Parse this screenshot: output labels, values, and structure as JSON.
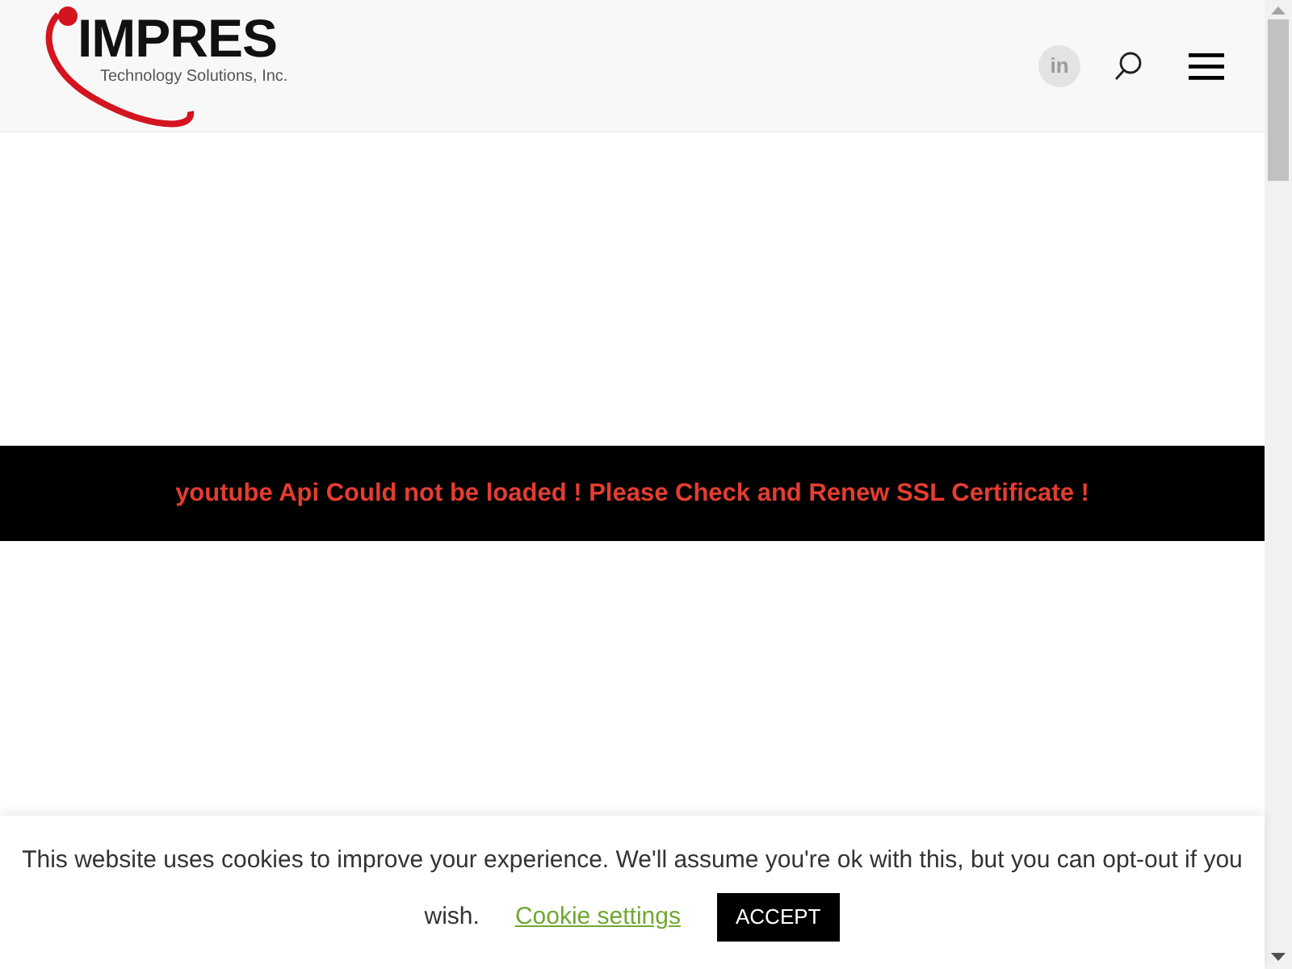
{
  "header": {
    "logo": {
      "name": "IMPRES",
      "tagline": "Technology Solutions, Inc."
    },
    "social_icon": "in"
  },
  "error_banner": {
    "message": "youtube Api Could not be loaded ! Please Check and Renew SSL Certificate !"
  },
  "cookie_bar": {
    "message_lines": [
      "This website uses cookies to improve your experience. We'll assume you're ok with this, but you can opt-out if you",
      "wish."
    ],
    "settings_link": "Cookie settings",
    "accept_button": "ACCEPT"
  }
}
